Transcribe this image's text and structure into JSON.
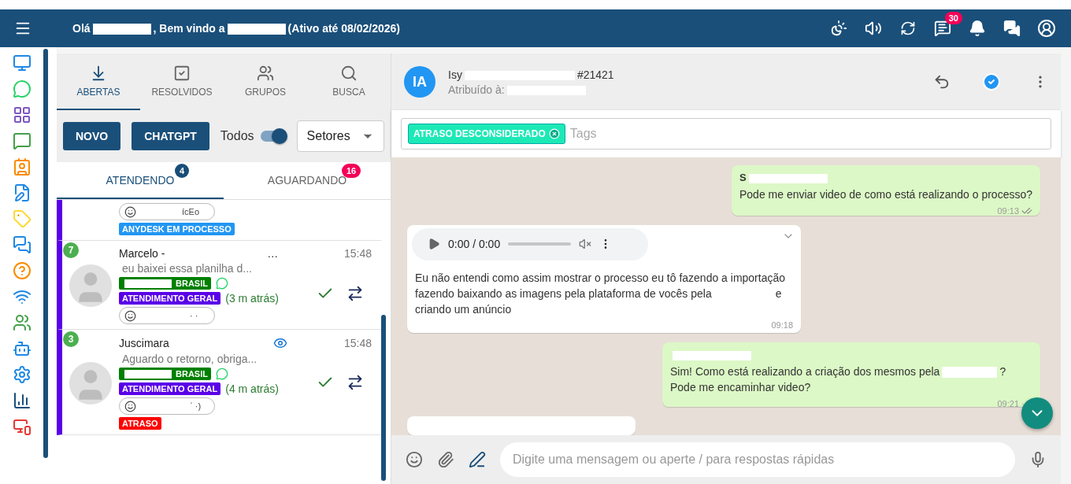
{
  "topbar": {
    "greeting": [
      {
        "kind": "text",
        "text": "Olá"
      },
      {
        "kind": "redacted"
      },
      {
        "kind": "text",
        "text": ", Bem vindo a"
      },
      {
        "kind": "redacted"
      },
      {
        "kind": "text",
        "text": "(Ativo até 08/02/2026)"
      }
    ],
    "chat_badge": "30"
  },
  "tabs": [
    {
      "label": "ABERTAS",
      "selected": true
    },
    {
      "label": "RESOLVIDOS",
      "selected": false
    },
    {
      "label": "GRUPOS",
      "selected": false
    },
    {
      "label": "BUSCA",
      "selected": false
    }
  ],
  "buttons": [
    "NOVO",
    "CHATGPT"
  ],
  "filter": {
    "label": "Todos",
    "on": true
  },
  "sector_select": {
    "value": "Setores"
  },
  "subtabs": [
    {
      "label": "ATENDENDO",
      "selected": true,
      "count": "4",
      "color": "#174d78"
    },
    {
      "label": "AGUARDANDO",
      "selected": false,
      "count": "16",
      "color": "#f50057"
    }
  ],
  "tickets": [
    {
      "partial": true,
      "user_tail": "ícEo",
      "tags": [
        {
          "label": "ANYDESK EM PROCESSO",
          "color": "#2196f3"
        }
      ]
    },
    {
      "partial": false,
      "unread": "7",
      "name": "Marcelo - ",
      "name_tail": "…",
      "viewed": false,
      "time": "15:48",
      "preview": "eu baixei essa planilha d...",
      "connection": "BRASIL",
      "queue": "ATENDIMENTO GERAL",
      "ago": "(3 m atrás)",
      "user_tail": "· ·"
    },
    {
      "partial": false,
      "unread": "3",
      "name": "Juscimara",
      "viewed": true,
      "time": "15:48",
      "preview": "Aguardo o retorno, obriga...",
      "connection": "BRASIL",
      "queue": "ATENDIMENTO GERAL",
      "ago": "(4 m atrás)",
      "user_tail": "ˊ ·)",
      "tags": [
        {
          "label": "ATRASO",
          "color": "#ff0000"
        }
      ]
    }
  ],
  "chat": {
    "avatar": "IA",
    "title_start": "Isy",
    "title_end": "#21421",
    "assigned": "Atribuído à:",
    "tags": [
      {
        "label": "ATRASO DESCONSIDERADO",
        "color": "#1de9b6"
      }
    ],
    "tags_placeholder": "Tags",
    "messages": [
      {
        "kind": "text",
        "outgoing": true,
        "sender": "S",
        "text": [
          {
            "kind": "text",
            "text": "Pode me enviar video de como está realizando o processo?"
          }
        ],
        "time": "09:13",
        "read": true
      },
      {
        "kind": "audio",
        "outgoing": false,
        "player_time": "0:00 / 0:00",
        "text": [
          {
            "kind": "text",
            "text": "Eu não entendi como assim mostrar o processo eu tô fazendo a importação fazendo baixando as imagens pela plataforma de vocês pela"
          },
          {
            "kind": "redacted"
          },
          {
            "kind": "text",
            "text": "e criando um anúncio"
          }
        ],
        "time": "09:18"
      },
      {
        "kind": "text",
        "outgoing": true,
        "text": [
          {
            "kind": "text",
            "text": "Sim! Como está realizando a criação dos mesmos pela"
          },
          {
            "kind": "redacted"
          },
          {
            "kind": "text",
            "text": "? Pode me encaminhar video?"
          }
        ],
        "time": "09:21",
        "read": false
      },
      {
        "kind": "cut",
        "outgoing": false
      }
    ],
    "input_placeholder": "Digite uma mensagem ou aperte / para respostas rápidas"
  }
}
